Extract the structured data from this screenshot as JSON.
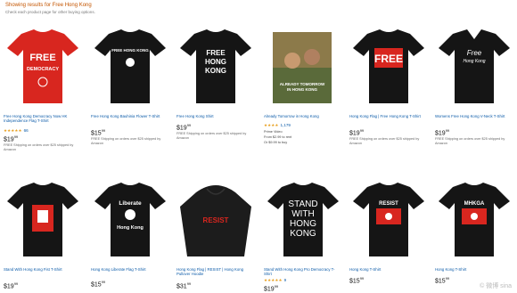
{
  "header": {
    "results_title": "Showing results for Free Hong Kong",
    "results_sub": "Check each product page for other buying options."
  },
  "colors": {
    "red": "#d8261f",
    "black": "#151515",
    "link": "#0a5aa8",
    "star": "#e8a020"
  },
  "products": [
    {
      "title": "Free Hong Kong Democracy Now HK Independence Flag T-Shirt",
      "stars": "★★★★★",
      "count": "66",
      "price": "$19",
      "cents": "99",
      "ship": "FREE Shipping on orders over $25 shipped by Amazon",
      "shirt_lines": [
        "FREE",
        "DEMOCRACY"
      ]
    },
    {
      "title": "Free Hong Kong Bauhinia Flower T-Shirt",
      "stars": "",
      "count": "",
      "price": "$15",
      "cents": "99",
      "ship": "FREE Shipping on orders over $25 shipped by Amazon",
      "shirt_lines": [
        "FREE HONG KONG"
      ]
    },
    {
      "title": "Free Hong Kong Shirt",
      "stars": "",
      "count": "",
      "price": "$19",
      "cents": "99",
      "ship": "FREE Shipping on orders over $25 shipped by Amazon",
      "shirt_lines": [
        "FREE",
        "HONG",
        "KONG"
      ]
    },
    {
      "title": "Already Tomorrow in Hong Kong",
      "stars": "★★★★",
      "count": "1,179",
      "price": "$2",
      "cents": "99",
      "ship": "Prime Video",
      "extra": [
        "From $2.99 to rent",
        "Or $9.99 to buy"
      ],
      "shirt_lines": [
        "ALREADY TOMORROW",
        "IN HONG KONG"
      ]
    },
    {
      "title": "Hong Kong Flag | Free Hong Kong T-Shirt",
      "stars": "",
      "count": "",
      "price": "$19",
      "cents": "99",
      "ship": "FREE Shipping on orders over $25 shipped by Amazon",
      "shirt_lines": [
        "FREE"
      ]
    },
    {
      "title": "Womens Free Hong Kong V-Neck T-Shirt",
      "stars": "",
      "count": "",
      "price": "$19",
      "cents": "99",
      "ship": "FREE Shipping on orders over $25 shipped by Amazon",
      "shirt_lines": [
        "Free",
        "Hong Kong"
      ]
    },
    {
      "title": "Stand With Hong Kong Fist T-Shirt",
      "stars": "",
      "count": "",
      "price": "$19",
      "cents": "99",
      "ship": "FREE Shipping on orders over $25 shipped by Amazon",
      "shirt_lines": []
    },
    {
      "title": "Hong Kong Liberate Flag T-Shirt",
      "stars": "",
      "count": "",
      "price": "$15",
      "cents": "99",
      "ship": "FREE Shipping on orders over $25 shipped by Amazon",
      "shirt_lines": [
        "Liberate",
        "Hong Kong"
      ]
    },
    {
      "title": "Hong Kong Flag | RESIST | Hong Kong Pullover Hoodie",
      "stars": "",
      "count": "",
      "price": "$31",
      "cents": "99",
      "ship": "FREE Shipping on orders over $25 shipped by Amazon",
      "shirt_lines": [
        "RESIST"
      ]
    },
    {
      "title": "Stand With Hong Kong Pro Democracy T-Shirt",
      "stars": "★★★★★",
      "count": "9",
      "price": "$19",
      "cents": "99",
      "ship": "FREE Shipping on orders over $25 shipped by Amazon",
      "shirt_lines": [
        "STAND",
        "WITH",
        "HONG",
        "KONG"
      ]
    },
    {
      "title": "Hong Kong T-Shirt",
      "stars": "",
      "count": "",
      "price": "$15",
      "cents": "99",
      "ship": "FREE Shipping on orders over $25 shipped by Amazon",
      "shirt_lines": [
        "RESIST"
      ]
    },
    {
      "title": "Hong Kong T-Shirt",
      "stars": "",
      "count": "",
      "price": "$15",
      "cents": "99",
      "ship": "FREE Shipping on orders over $25 shipped by Amazon",
      "shirt_lines": [
        "MHKGA"
      ]
    }
  ],
  "watermark": "© 微博 sina"
}
